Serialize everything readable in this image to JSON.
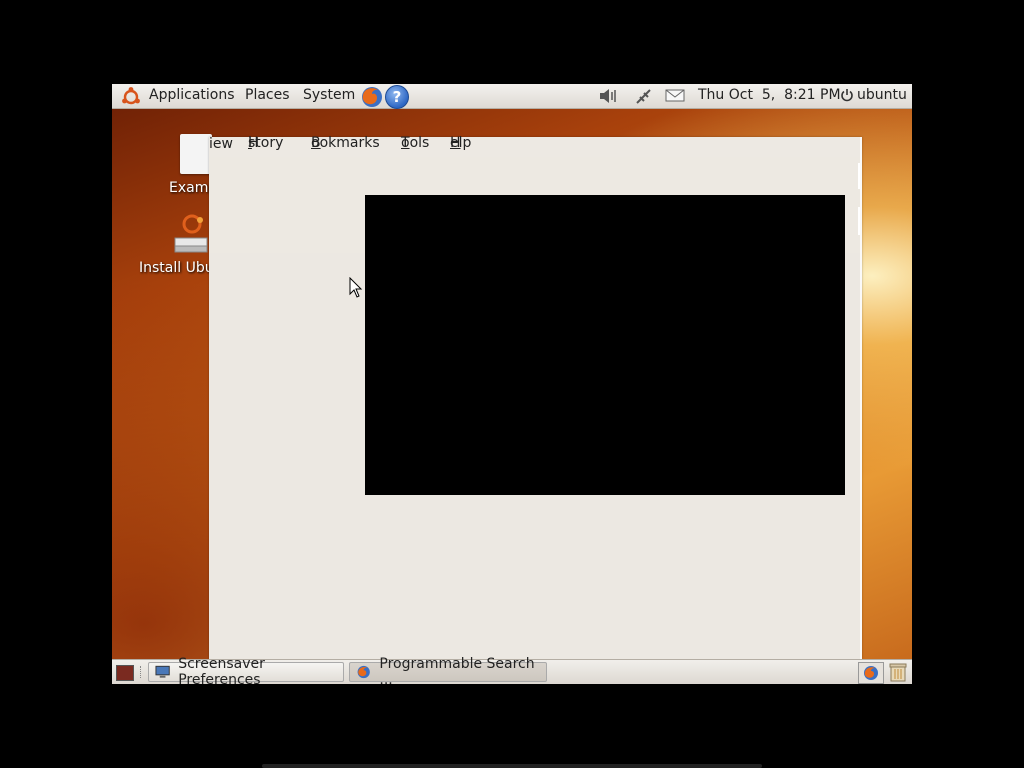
{
  "top_panel": {
    "menus": {
      "applications": "Applications",
      "places": "Places",
      "system": "System"
    },
    "clock": "Thu Oct  5,  8:21 PM",
    "user": "ubuntu"
  },
  "desktop": {
    "icons": [
      {
        "label": "Examp"
      },
      {
        "label": "Install Ubu"
      }
    ]
  },
  "window": {
    "menubar": {
      "view": "iew",
      "history": {
        "pre": "H",
        "u": "i",
        "post": "story"
      },
      "bookmarks": {
        "u": "B",
        "post": "ookmarks"
      },
      "tools": {
        "u": "T",
        "post": "ools"
      },
      "help": {
        "u": "H",
        "post": "elp"
      }
    }
  },
  "taskbar": {
    "tasks": [
      {
        "label": "Screensaver Preferences"
      },
      {
        "label": "Programmable Search ..."
      }
    ]
  },
  "colors": {
    "accent": "#d4741c",
    "panel": "#e9e6e1",
    "window_bg": "#ece8e2"
  }
}
